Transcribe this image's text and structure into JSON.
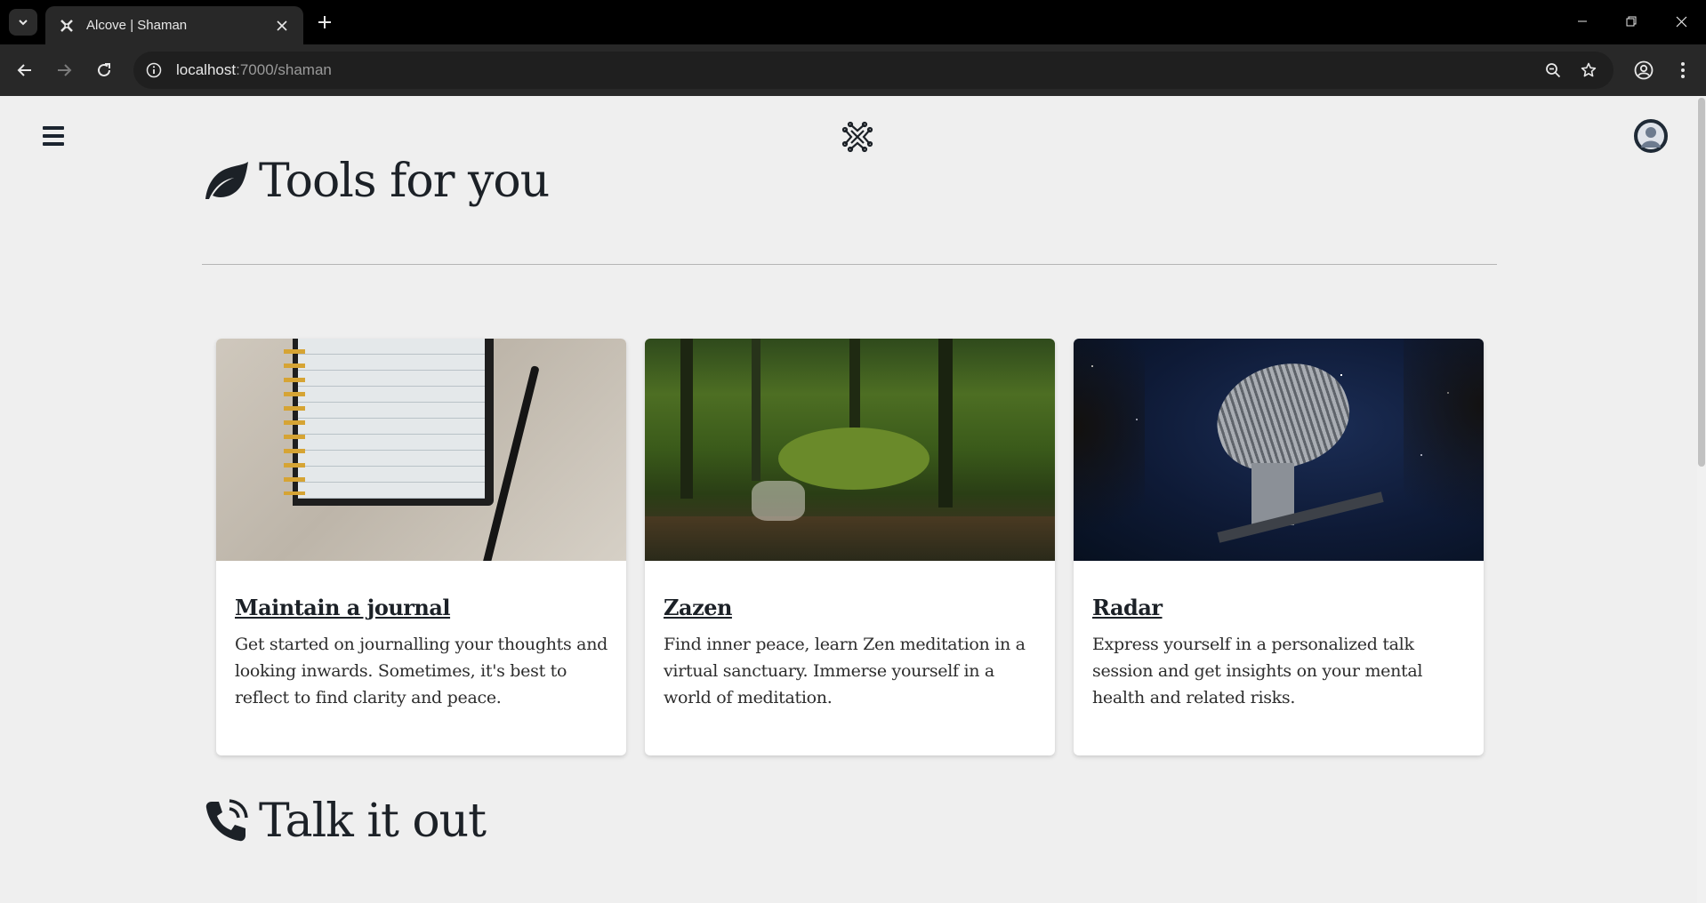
{
  "browser": {
    "tab": {
      "title": "Alcove | Shaman"
    },
    "address": {
      "host": "localhost",
      "rest": ":7000/shaman"
    }
  },
  "page": {
    "sections": [
      {
        "title": "Tools for you",
        "icon": "leaf-icon"
      },
      {
        "title": "Talk it out",
        "icon": "phone-icon"
      }
    ],
    "cards": [
      {
        "title": "Maintain a journal",
        "description": "Get started on journalling your thoughts and looking inwards. Sometimes, it's best to reflect to find clarity and peace.",
        "image": "notebook-and-pen-image"
      },
      {
        "title": "Zazen",
        "description": "Find inner peace, learn Zen meditation in a virtual sanctuary. Immerse yourself in a world of meditation.",
        "image": "forest-stream-image"
      },
      {
        "title": "Radar",
        "description": "Express yourself in a personalized talk session and get insights on your mental health and related risks.",
        "image": "radar-dish-night-image"
      }
    ]
  },
  "colors": {
    "page_background": "#efefef",
    "heading": "#1c2127",
    "chrome_dark": "#282828"
  }
}
